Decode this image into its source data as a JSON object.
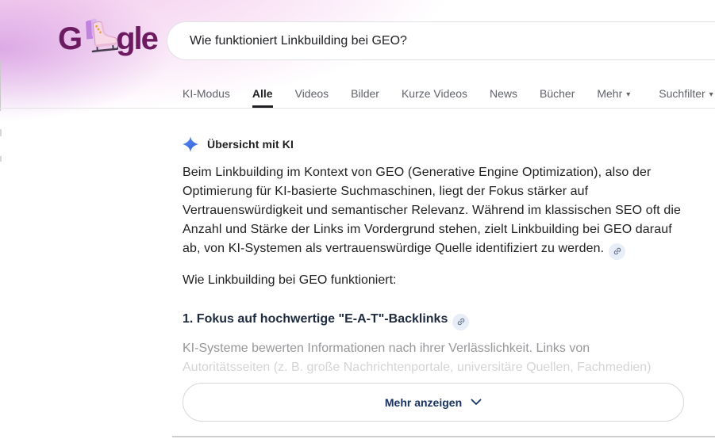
{
  "logo": {
    "part1": "G",
    "part2": "gle",
    "doodle": "ice-skate-doodle",
    "color": "#6d1b61"
  },
  "search": {
    "query": "Wie funktioniert Linkbuilding bei GEO?"
  },
  "tabs": {
    "items": [
      {
        "label": "KI-Modus",
        "active": false
      },
      {
        "label": "Alle",
        "active": true
      },
      {
        "label": "Videos",
        "active": false
      },
      {
        "label": "Bilder",
        "active": false
      },
      {
        "label": "Kurze Videos",
        "active": false
      },
      {
        "label": "News",
        "active": false
      },
      {
        "label": "Bücher",
        "active": false
      },
      {
        "label": "Mehr",
        "active": false,
        "caret": true
      },
      {
        "label": "Suchfilter",
        "active": false,
        "caret": true
      }
    ],
    "caret_glyph": "▾"
  },
  "ai_overview": {
    "label": "Übersicht mit KI",
    "sparkle_icon": "gemini-sparkle-icon",
    "paragraph": "Beim Linkbuilding im Kontext von GEO (Generative Engine Optimization), also der Optimierung für KI-basierte Suchmaschinen, liegt der Fokus stärker auf Vertrauenswürdigkeit und semantischer Relevanz. Während im klassischen SEO oft die Anzahl und Stärke der Links im Vordergrund stehen, zielt Linkbuilding bei GEO darauf ab, von KI-Systemen als vertrauenswürdige Quelle identifiziert zu werden.",
    "intro_line": "Wie Linkbuilding bei GEO funktioniert:",
    "section_heading": "1. Fokus auf hochwertige \"E-A-T\"-Backlinks",
    "faded_line1": "KI-Systeme bewerten Informationen nach ihrer Verlässlichkeit. Links von",
    "faded_line2": "Autoritätsseiten (z. B. große Nachrichtenportale, universitäre Quellen, Fachmedien)",
    "show_more_label": "Mehr anzeigen",
    "colors": {
      "sparkle_blue": "#4a7cf0",
      "heading_navy": "#1e2b3e",
      "show_more_navy": "#173261",
      "body_text": "#1f1f1f",
      "link_chip_bg": "#e8eef8",
      "accent_pink": "#f2c6eb",
      "accent_purple": "#c578d8"
    }
  }
}
